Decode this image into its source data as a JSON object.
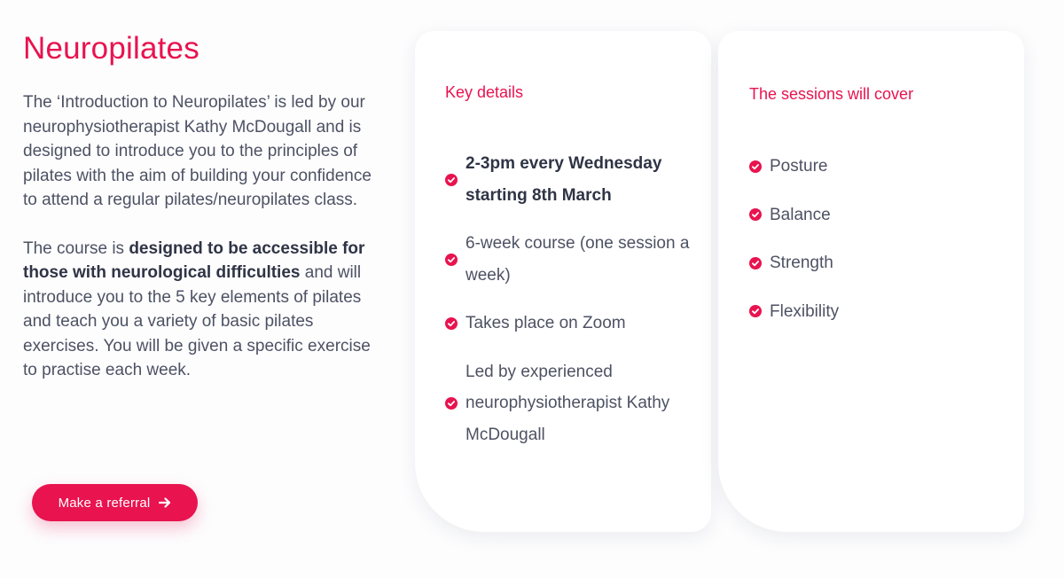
{
  "intro": {
    "title": "Neuropilates",
    "paragraph1": "The ‘Introduction to Neuropilates’ is led by our neurophysiotherapist Kathy McDougall and is designed to introduce you to the principles of pilates with the aim of building your confidence to attend a regular pilates/neuropilates class.",
    "paragraph2_start": "The course is ",
    "paragraph2_bold": "designed to be accessible for those with neurological difficulties",
    "paragraph2_end": " and will introduce you to the 5 key elements of pilates and teach you a variety of basic pilates exercises. You will be given a specific exercise to practise each week."
  },
  "referral_button": {
    "label": "Make a referral",
    "icon": "arrow-right-icon"
  },
  "key_details": {
    "title": "Key details",
    "items": [
      "2-3pm every Wednesday starting 8th March",
      "6-week course (one session a week)",
      "Takes place on Zoom",
      "Led by experienced neurophysiotherapist Kathy McDougall"
    ]
  },
  "sessions": {
    "title": "The sessions will cover",
    "items": [
      "Posture",
      "Balance",
      "Strength",
      "Flexibility"
    ]
  },
  "colors": {
    "accent": "#e8134f",
    "body_text": "#4d5263",
    "strong_text": "#2f3445"
  },
  "icons": {
    "check": "check-circle-icon"
  }
}
